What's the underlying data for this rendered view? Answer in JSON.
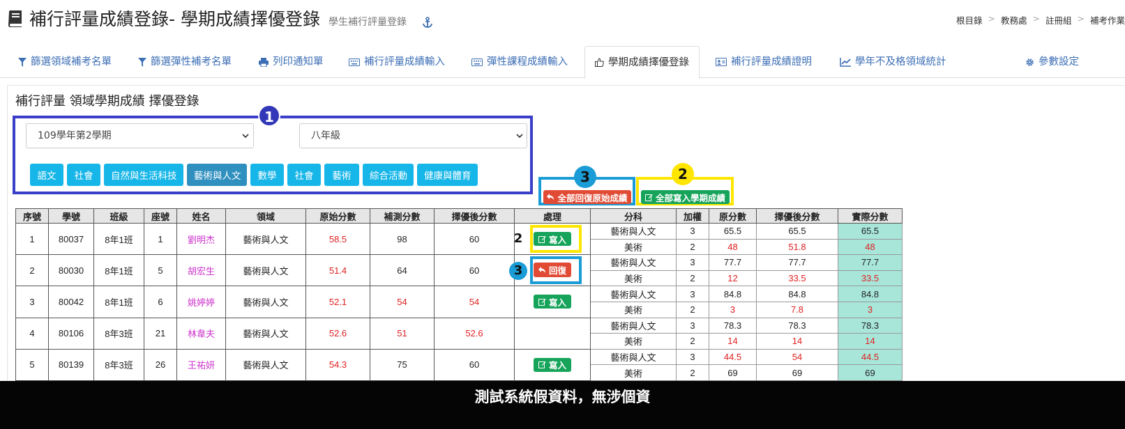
{
  "header": {
    "title": "補行評量成績登錄- 學期成績擇優登錄",
    "subtitle": "學生補行評量登錄",
    "title_icon": "book-icon",
    "anchor_icon": "anchor-icon"
  },
  "breadcrumb": [
    "根目錄",
    "教務處",
    "註冊組",
    "補考作業"
  ],
  "tabs": [
    {
      "label": "篩選領域補考名單",
      "icon": "filter-icon"
    },
    {
      "label": "篩選彈性補考名單",
      "icon": "filter-icon"
    },
    {
      "label": "列印通知單",
      "icon": "print-icon"
    },
    {
      "label": "補行評量成績輸入",
      "icon": "keyboard-icon"
    },
    {
      "label": "彈性課程成績輸入",
      "icon": "keyboard-icon"
    },
    {
      "label": "學期成績擇優登錄",
      "icon": "thumbs-up-icon",
      "active": true
    },
    {
      "label": "補行評量成績證明",
      "icon": "id-card-icon"
    },
    {
      "label": "學年不及格領域統計",
      "icon": "line-chart-icon"
    },
    {
      "label": "參數設定",
      "icon": "gear-icon"
    }
  ],
  "panel_title": "補行評量 領域學期成績 擇優登錄",
  "filters": {
    "semester": "109學年第2學期",
    "grade": "八年級"
  },
  "subjects": [
    "語文",
    "社會",
    "自然與生活科技",
    "藝術與人文",
    "數學",
    "社會",
    "藝術",
    "綜合活動",
    "健康與體育"
  ],
  "active_subject": "藝術與人文",
  "actions": {
    "restore_all": "全部回復原始成績",
    "write_all": "全部寫入學期成績",
    "write": "寫入",
    "restore": "回復"
  },
  "callouts": {
    "one": "1",
    "two": "2",
    "three": "3"
  },
  "table": {
    "headers": [
      "序號",
      "學號",
      "班級",
      "座號",
      "姓名",
      "領域",
      "原始分數",
      "補測分數",
      "擇優後分數",
      "處理",
      "分科",
      "加權",
      "原分數",
      "擇優後分數",
      "實際分數"
    ],
    "rows": [
      {
        "no": "1",
        "id": "80037",
        "class": "8年1班",
        "seat": "1",
        "name": "劉明杰",
        "domain": "藝術與人文",
        "orig": "58.5",
        "retest": "98",
        "best": "60",
        "action": "write",
        "subs": [
          {
            "name": "藝術與人文",
            "weight": "3",
            "orig": "65.5",
            "best": "65.5",
            "actual": "65.5"
          },
          {
            "name": "美術",
            "weight": "2",
            "orig": "48",
            "best": "51.8",
            "actual": "48"
          }
        ]
      },
      {
        "no": "2",
        "id": "80030",
        "class": "8年1班",
        "seat": "5",
        "name": "胡宏生",
        "domain": "藝術與人文",
        "orig": "51.4",
        "retest": "64",
        "best": "60",
        "action": "restore",
        "subs": [
          {
            "name": "藝術與人文",
            "weight": "3",
            "orig": "77.7",
            "best": "77.7",
            "actual": "77.7"
          },
          {
            "name": "美術",
            "weight": "2",
            "orig": "12",
            "best": "33.5",
            "actual": "33.5"
          }
        ]
      },
      {
        "no": "3",
        "id": "80042",
        "class": "8年1班",
        "seat": "6",
        "name": "姚婷婷",
        "domain": "藝術與人文",
        "orig": "52.1",
        "retest": "54",
        "best": "54",
        "action": "write",
        "subs": [
          {
            "name": "藝術與人文",
            "weight": "3",
            "orig": "84.8",
            "best": "84.8",
            "actual": "84.8"
          },
          {
            "name": "美術",
            "weight": "2",
            "orig": "3",
            "best": "7.8",
            "actual": "3"
          }
        ]
      },
      {
        "no": "4",
        "id": "80106",
        "class": "8年3班",
        "seat": "21",
        "name": "林韋夫",
        "domain": "藝術與人文",
        "orig": "52.6",
        "retest": "51",
        "best": "52.6",
        "action": "",
        "subs": [
          {
            "name": "藝術與人文",
            "weight": "3",
            "orig": "78.3",
            "best": "78.3",
            "actual": "78.3"
          },
          {
            "name": "美術",
            "weight": "2",
            "orig": "14",
            "best": "14",
            "actual": "14"
          }
        ]
      },
      {
        "no": "5",
        "id": "80139",
        "class": "8年3班",
        "seat": "26",
        "name": "王祐妍",
        "domain": "藝術與人文",
        "orig": "54.3",
        "retest": "75",
        "best": "60",
        "action": "write",
        "subs": [
          {
            "name": "藝術與人文",
            "weight": "3",
            "orig": "44.5",
            "best": "54",
            "actual": "44.5"
          },
          {
            "name": "美術",
            "weight": "2",
            "orig": "69",
            "best": "69",
            "actual": "69"
          }
        ]
      }
    ]
  },
  "footer": "測試系統假資料，無涉個資",
  "colors": {
    "accent": "#3c6eb4",
    "subject_button": "#17b6e8",
    "danger": "#e14b35",
    "success": "#16a35a",
    "highlight": "#a8e6da",
    "score_red": "#e02020",
    "name_pink": "#cc33cc"
  }
}
